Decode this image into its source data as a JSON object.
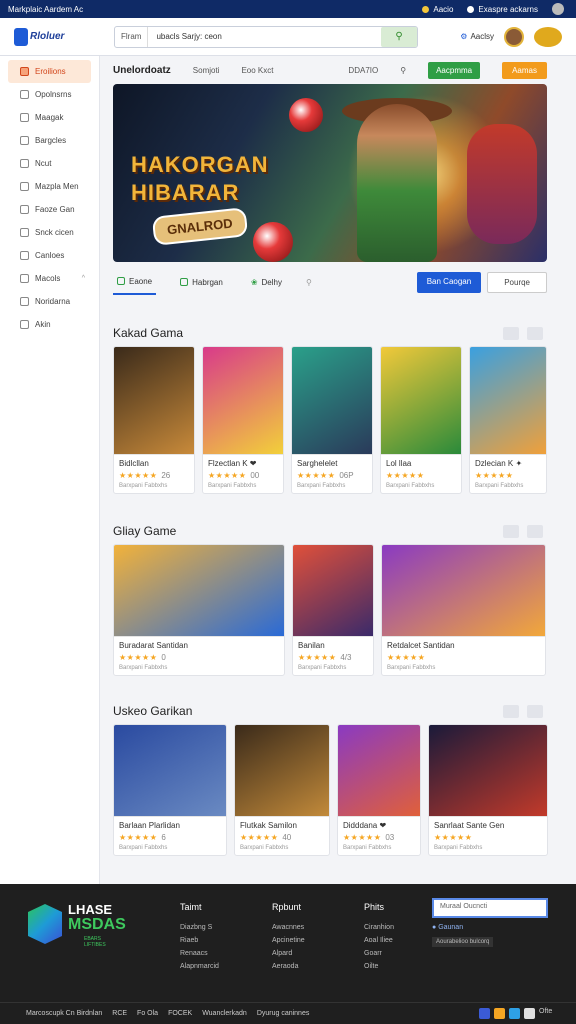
{
  "topbar": {
    "title": "Markplaic Aardem Ac",
    "links": [
      "Aacio",
      "Exaspre ackarns"
    ]
  },
  "header": {
    "logo": "Rloluer",
    "search_scope": "Flram",
    "search_value": "ubacls Sarjy: ceon",
    "user_label": "Aaclsy"
  },
  "sidebar": {
    "items": [
      {
        "label": "Eroilions",
        "active": true
      },
      {
        "label": "Opolnsrns"
      },
      {
        "label": "Maagak"
      },
      {
        "label": "Bargcles"
      },
      {
        "label": "Ncut"
      },
      {
        "label": "Mazpla Men"
      },
      {
        "label": "Faoze Gan"
      },
      {
        "label": "Snck cicen"
      },
      {
        "label": "Canloes"
      },
      {
        "label": "Macols",
        "chev": "^"
      },
      {
        "label": "Noridarna"
      },
      {
        "label": "Akin"
      }
    ]
  },
  "subnav": {
    "items": [
      "Unelordoatz",
      "Somjoti",
      "Eoo Kxct",
      "DDA7IO"
    ],
    "btn_green": "Aacpmma",
    "btn_orange": "Aamas"
  },
  "hero": {
    "title1": "HAKORGAN",
    "title2": "HIBARAR",
    "badge": "GNALROD"
  },
  "tabs": {
    "items": [
      "Eaone",
      "Habrgan",
      "Delhy"
    ],
    "btn_blue": "Ban Caogan",
    "btn_white": "Pourqe"
  },
  "sections": [
    {
      "title": "Kakad Gama",
      "cards": [
        {
          "name": "Bidlcllan",
          "rating": "★★★★★",
          "rv": "26",
          "sub": "Barxpani Fabbxhs"
        },
        {
          "name": "Flzectlan  K ❤",
          "rating": "★★★★★",
          "rv": "00",
          "sub": "Barxpani Fabbxhs"
        },
        {
          "name": "Sarghelelet",
          "rating": "★★★★★",
          "rv": "06P",
          "sub": "Barxpani Fabbxhs"
        },
        {
          "name": "Lol llaa",
          "rating": "★★★★★",
          "rv": "",
          "sub": "Barxpani Fabbxhs"
        },
        {
          "name": "Dzlecian  K ✦",
          "rating": "★★★★★",
          "rv": "",
          "sub": "Barxpani Fabbxhs"
        }
      ]
    },
    {
      "title": "Gliay Game",
      "cards": [
        {
          "name": "Buradarat Santidan",
          "rating": "★★★★★",
          "rv": "0",
          "sub": "Barxpani Fabbxhs"
        },
        {
          "name": "Banilan",
          "rating": "★★★★★",
          "rv": "4/3",
          "sub": "Barxpani Fabbxhs"
        },
        {
          "name": "Retdalcet Santidan",
          "rating": "★★★★★",
          "rv": "",
          "sub": "Barxpani Fabbxhs"
        }
      ]
    },
    {
      "title": "Uskeo Garikan",
      "cards": [
        {
          "name": "Barlaan Plarlidan",
          "rating": "★★★★★",
          "rv": "6",
          "sub": "Barxpani Fabbxhs"
        },
        {
          "name": "Flutkak  Samilon",
          "rating": "★★★★★",
          "rv": "40",
          "sub": "Barxpani Fabbxhs"
        },
        {
          "name": "Didddana  ❤",
          "rating": "★★★★★",
          "rv": "03",
          "sub": "Barxpani Fabbxhs"
        },
        {
          "name": "Sanrlaat Sante Gen",
          "rating": "★★★★★",
          "rv": "",
          "sub": "Barxpani Fabbxhs"
        }
      ]
    }
  ],
  "footer": {
    "logo1": "LHASE",
    "logo2": "MSDAS",
    "logo3": "EBARS LIFTIBES",
    "cols": [
      {
        "title": "Taimt",
        "items": [
          "Diazbng S",
          "Riaeb",
          "Renaacs",
          "Alapnmarcid"
        ]
      },
      {
        "title": "Rpbunt",
        "items": [
          "Awacnnes",
          "Apcinetine",
          "Alpard",
          "Aeraoda"
        ]
      },
      {
        "title": "Phits",
        "items": [
          "Ciranhion",
          "Aoal Iliee",
          "Goarr",
          "Oilte"
        ]
      }
    ],
    "newsletter_placeholder": "Muraal Oucncti",
    "newsletter_check": "Gaunan",
    "newsletter_tag": "Aourabelioo bulcorq",
    "bottom_links": [
      "Marcoscupk Cn Birdnlan",
      "RCE",
      "Fo Ola",
      "FOCEK",
      "Wuanclerkadn",
      "Dyurug caninnes"
    ],
    "social_right": "Ofte"
  }
}
